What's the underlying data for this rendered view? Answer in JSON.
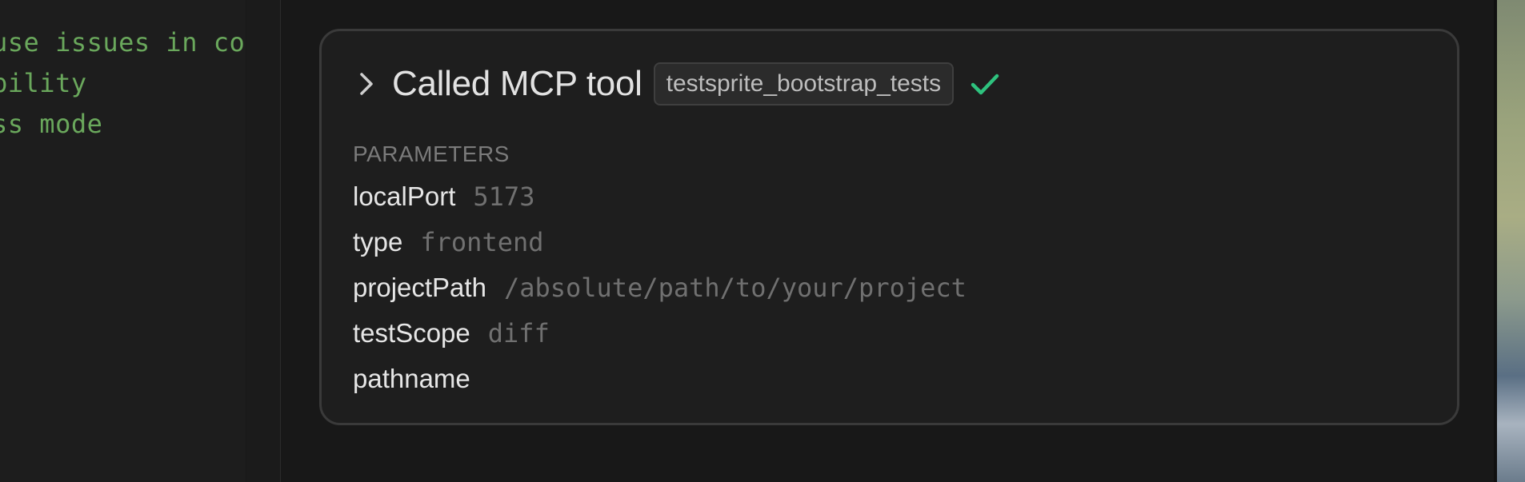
{
  "editor": {
    "code_lines": [
      "use issues in cont",
      "bility",
      "ss mode"
    ]
  },
  "tool_call": {
    "title": "Called MCP tool",
    "tool_name": "testsprite_bootstrap_tests",
    "status_icon": "check-icon",
    "status_color": "#2ec27e",
    "parameters_label": "PARAMETERS",
    "parameters": [
      {
        "key": "localPort",
        "value": "5173"
      },
      {
        "key": "type",
        "value": "frontend"
      },
      {
        "key": "projectPath",
        "value": "/absolute/path/to/your/project"
      },
      {
        "key": "testScope",
        "value": "diff"
      },
      {
        "key": "pathname",
        "value": ""
      }
    ]
  }
}
